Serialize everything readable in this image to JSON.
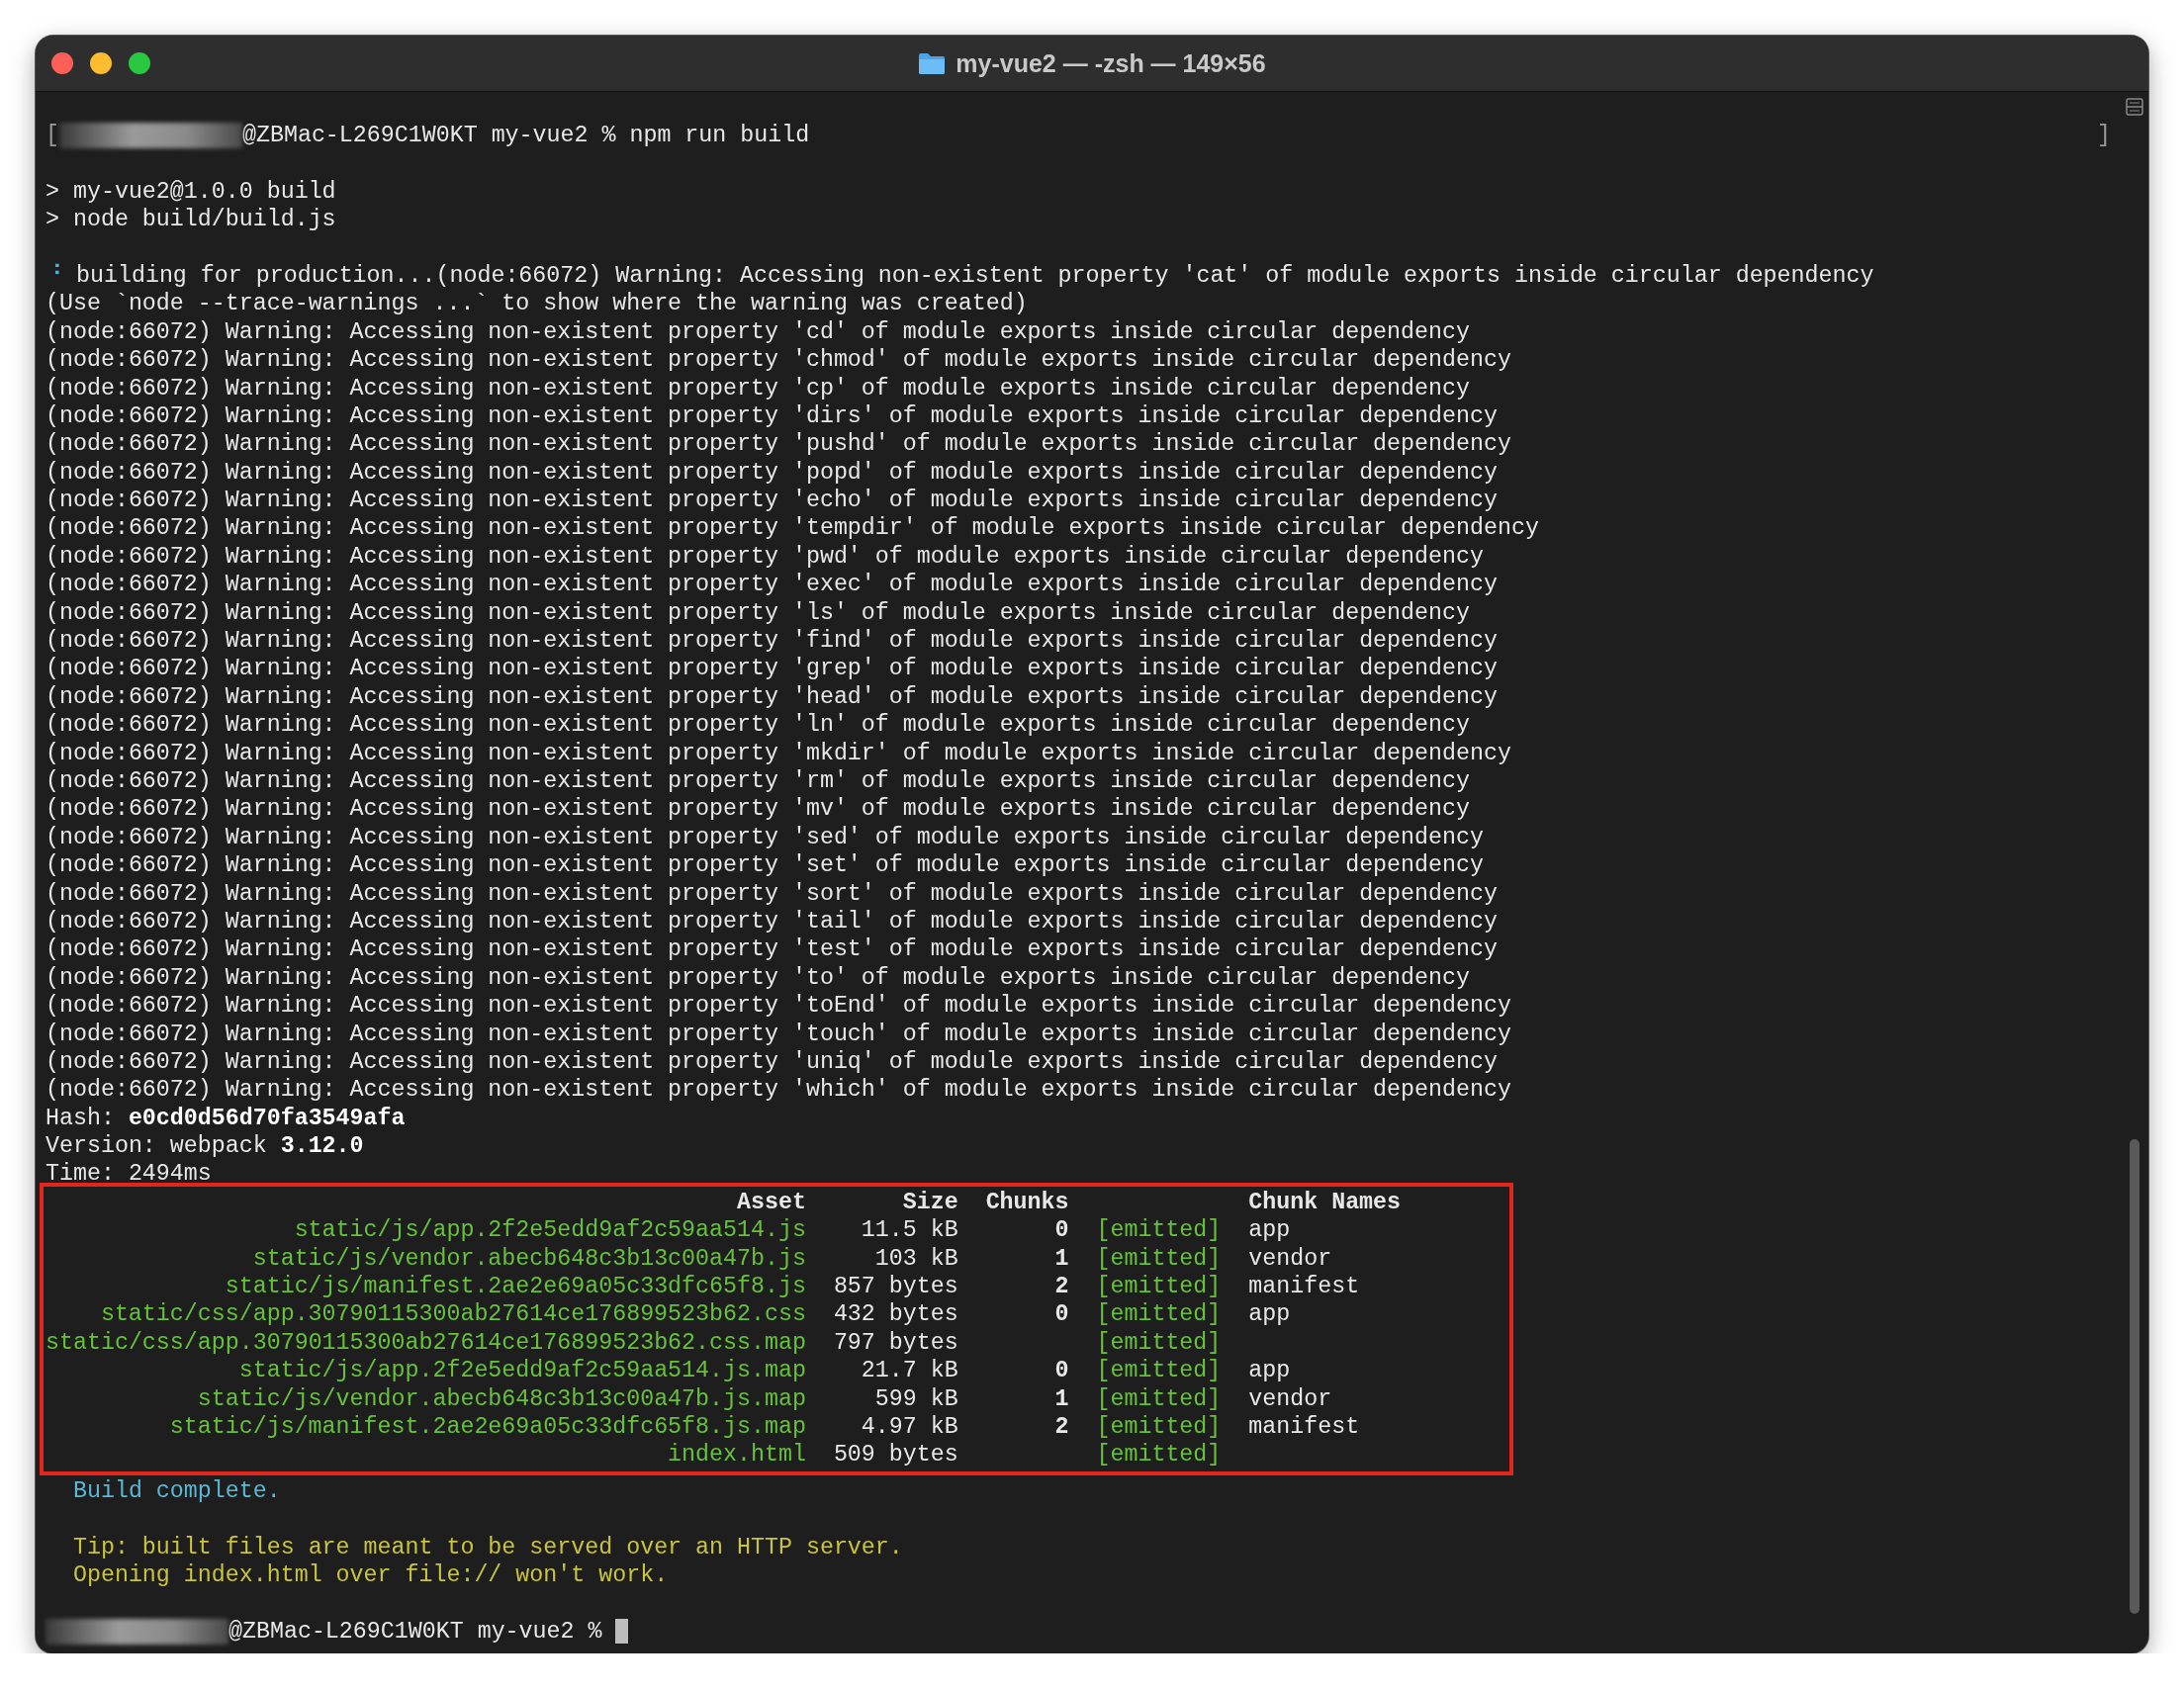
{
  "window": {
    "title": "my-vue2 — -zsh — 149×56"
  },
  "terminal": {
    "lines": [
      {
        "kind": "prompt",
        "bracket_left": "[",
        "text": "@ZBMac-L269C1W0KT my-vue2 % npm run build",
        "bracket_right": "]",
        "cursor": false
      },
      {
        "kind": "blank"
      },
      {
        "kind": "output",
        "text": "> my-vue2@1.0.0 build"
      },
      {
        "kind": "output",
        "text": "> node build/build.js"
      },
      {
        "kind": "blank"
      },
      {
        "kind": "spinner",
        "spinner": "⠘",
        "text": "building for production...(node:66072) Warning: Accessing non-existent property 'cat' of module exports inside circular dependency"
      },
      {
        "kind": "output",
        "text": "(Use `node --trace-warnings ...` to show where the warning was created)"
      },
      {
        "kind": "output",
        "text": "(node:66072) Warning: Accessing non-existent property 'cd' of module exports inside circular dependency"
      },
      {
        "kind": "output",
        "text": "(node:66072) Warning: Accessing non-existent property 'chmod' of module exports inside circular dependency"
      },
      {
        "kind": "output",
        "text": "(node:66072) Warning: Accessing non-existent property 'cp' of module exports inside circular dependency"
      },
      {
        "kind": "output",
        "text": "(node:66072) Warning: Accessing non-existent property 'dirs' of module exports inside circular dependency"
      },
      {
        "kind": "output",
        "text": "(node:66072) Warning: Accessing non-existent property 'pushd' of module exports inside circular dependency"
      },
      {
        "kind": "output",
        "text": "(node:66072) Warning: Accessing non-existent property 'popd' of module exports inside circular dependency"
      },
      {
        "kind": "output",
        "text": "(node:66072) Warning: Accessing non-existent property 'echo' of module exports inside circular dependency"
      },
      {
        "kind": "output",
        "text": "(node:66072) Warning: Accessing non-existent property 'tempdir' of module exports inside circular dependency"
      },
      {
        "kind": "output",
        "text": "(node:66072) Warning: Accessing non-existent property 'pwd' of module exports inside circular dependency"
      },
      {
        "kind": "output",
        "text": "(node:66072) Warning: Accessing non-existent property 'exec' of module exports inside circular dependency"
      },
      {
        "kind": "output",
        "text": "(node:66072) Warning: Accessing non-existent property 'ls' of module exports inside circular dependency"
      },
      {
        "kind": "output",
        "text": "(node:66072) Warning: Accessing non-existent property 'find' of module exports inside circular dependency"
      },
      {
        "kind": "output",
        "text": "(node:66072) Warning: Accessing non-existent property 'grep' of module exports inside circular dependency"
      },
      {
        "kind": "output",
        "text": "(node:66072) Warning: Accessing non-existent property 'head' of module exports inside circular dependency"
      },
      {
        "kind": "output",
        "text": "(node:66072) Warning: Accessing non-existent property 'ln' of module exports inside circular dependency"
      },
      {
        "kind": "output",
        "text": "(node:66072) Warning: Accessing non-existent property 'mkdir' of module exports inside circular dependency"
      },
      {
        "kind": "output",
        "text": "(node:66072) Warning: Accessing non-existent property 'rm' of module exports inside circular dependency"
      },
      {
        "kind": "output",
        "text": "(node:66072) Warning: Accessing non-existent property 'mv' of module exports inside circular dependency"
      },
      {
        "kind": "output",
        "text": "(node:66072) Warning: Accessing non-existent property 'sed' of module exports inside circular dependency"
      },
      {
        "kind": "output",
        "text": "(node:66072) Warning: Accessing non-existent property 'set' of module exports inside circular dependency"
      },
      {
        "kind": "output",
        "text": "(node:66072) Warning: Accessing non-existent property 'sort' of module exports inside circular dependency"
      },
      {
        "kind": "output",
        "text": "(node:66072) Warning: Accessing non-existent property 'tail' of module exports inside circular dependency"
      },
      {
        "kind": "output",
        "text": "(node:66072) Warning: Accessing non-existent property 'test' of module exports inside circular dependency"
      },
      {
        "kind": "output",
        "text": "(node:66072) Warning: Accessing non-existent property 'to' of module exports inside circular dependency"
      },
      {
        "kind": "output",
        "text": "(node:66072) Warning: Accessing non-existent property 'toEnd' of module exports inside circular dependency"
      },
      {
        "kind": "output",
        "text": "(node:66072) Warning: Accessing non-existent property 'touch' of module exports inside circular dependency"
      },
      {
        "kind": "output",
        "text": "(node:66072) Warning: Accessing non-existent property 'uniq' of module exports inside circular dependency"
      },
      {
        "kind": "output",
        "text": "(node:66072) Warning: Accessing non-existent property 'which' of module exports inside circular dependency"
      },
      {
        "kind": "output",
        "text": "Hash: **e0cd0d56d70fa3549afa**"
      },
      {
        "kind": "output",
        "text": "Version: webpack **3.12.0**"
      },
      {
        "kind": "output",
        "text": "Time: 2494ms"
      },
      {
        "kind": "table",
        "highlighted": true,
        "columns": [
          "Asset",
          "Size",
          "Chunks",
          "Chunk Names"
        ],
        "rows": [
          {
            "asset": "static/js/app.2f2e5edd9af2c59aa514.js",
            "size": "11.5 kB",
            "chunks": "0",
            "status": "[emitted]",
            "chunk_names": "app"
          },
          {
            "asset": "static/js/vendor.abecb648c3b13c00a47b.js",
            "size": "103 kB",
            "chunks": "1",
            "status": "[emitted]",
            "chunk_names": "vendor"
          },
          {
            "asset": "static/js/manifest.2ae2e69a05c33dfc65f8.js",
            "size": "857 bytes",
            "chunks": "2",
            "status": "[emitted]",
            "chunk_names": "manifest"
          },
          {
            "asset": "static/css/app.30790115300ab27614ce176899523b62.css",
            "size": "432 bytes",
            "chunks": "0",
            "status": "[emitted]",
            "chunk_names": "app"
          },
          {
            "asset": "static/css/app.30790115300ab27614ce176899523b62.css.map",
            "size": "797 bytes",
            "status": "[emitted]"
          },
          {
            "asset": "static/js/app.2f2e5edd9af2c59aa514.js.map",
            "size": "21.7 kB",
            "chunks": "0",
            "status": "[emitted]",
            "chunk_names": "app"
          },
          {
            "asset": "static/js/vendor.abecb648c3b13c00a47b.js.map",
            "size": "599 kB",
            "chunks": "1",
            "status": "[emitted]",
            "chunk_names": "vendor"
          },
          {
            "asset": "static/js/manifest.2ae2e69a05c33dfc65f8.js.map",
            "size": "4.97 kB",
            "chunks": "2",
            "status": "[emitted]",
            "chunk_names": "manifest"
          },
          {
            "asset": "index.html",
            "size": "509 bytes",
            "status": "[emitted]"
          }
        ]
      },
      {
        "kind": "success",
        "text": "  Build complete."
      },
      {
        "kind": "blank"
      },
      {
        "kind": "tip",
        "text": "  Tip: built files are meant to be served over an HTTP server."
      },
      {
        "kind": "tip",
        "text": "  Opening index.html over file:// won't work."
      },
      {
        "kind": "blank"
      },
      {
        "kind": "prompt",
        "text": "@ZBMac-L269C1W0KT my-vue2 %",
        "cursor": true
      }
    ]
  }
}
